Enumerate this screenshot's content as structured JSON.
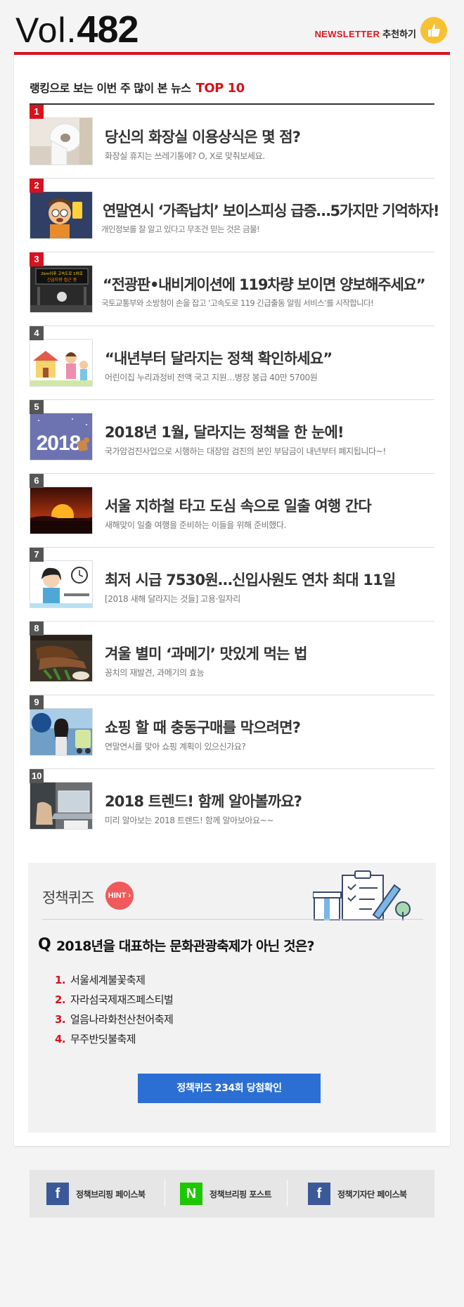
{
  "header": {
    "vol_prefix": "Vol.",
    "vol_number": "482",
    "newsletter_label": "NEWSLETTER",
    "recommend_label": "추천하기"
  },
  "section": {
    "title": "랭킹으로 보는 이번 주 많이 본 뉴스",
    "top_label": "TOP 10"
  },
  "items": [
    {
      "rank": "1",
      "title": "당신의 화장실 이용상식은 몇 점?",
      "subtitle": "화장실 휴지는 쓰레기통에? O, X로 맞춰보세요."
    },
    {
      "rank": "2",
      "title": "연말연시 ‘가족납치’ 보이스피싱 급증…5가지만 기억하자!",
      "subtitle": "개인정보를 잘 알고 있다고 무조건 믿는 것은 금물!"
    },
    {
      "rank": "3",
      "title": "“전광판•내비게이션에 119차량 보이면 양보해주세요”",
      "subtitle": "국토교통부와 소방청이 손을 잡고 ‘고속도로 119 긴급출동 알림 서비스’를 시작합니다!"
    },
    {
      "rank": "4",
      "title": "“내년부터 달라지는 정책 확인하세요”",
      "subtitle": "어린이집 누리과정비 전액 국고 지원…병장 봉급 40만 5700원"
    },
    {
      "rank": "5",
      "title": "2018년 1월, 달라지는 정책을 한 눈에!",
      "subtitle": "국가암검진사업으로 시행하는 대장암 검진의 본인 부담금이 내년부터 폐지됩니다~!"
    },
    {
      "rank": "6",
      "title": "서울 지하철 타고 도심 속으로 일출 여행 간다",
      "subtitle": "새해맞이 일출 여행을 준비하는 이들을 위해 준비했다."
    },
    {
      "rank": "7",
      "title": "최저 시급 7530원…신입사원도 연차 최대 11일",
      "subtitle": "[2018 새해 달라지는 것들] 고용·일자리"
    },
    {
      "rank": "8",
      "title": "겨울 별미 ‘과메기’ 맛있게 먹는 법",
      "subtitle": "꽁치의 재발견, 과메기의 효능"
    },
    {
      "rank": "9",
      "title": "쇼핑 할 때 충동구매를 막으려면?",
      "subtitle": "연말연시를 맞아 쇼핑 계획이 있으신가요?"
    },
    {
      "rank": "10",
      "title": "2018 트렌드! 함께 알아볼까요?",
      "subtitle": "미리 알아보는 2018 트렌드! 함께 알아보아요~~"
    }
  ],
  "thumb_texts": {
    "item3_sign_line1": "2km이후 고속도로 1차로",
    "item3_sign_line2": "긴급차량 접근 중",
    "item5_year": "2018"
  },
  "quiz": {
    "title": "정책퀴즈",
    "hint_label": "HINT",
    "q_mark": "Q",
    "question": "2018년을 대표하는 문화관광축제가 아닌 것은?",
    "options": [
      {
        "num": "1.",
        "text": "서울세계불꽃축제"
      },
      {
        "num": "2.",
        "text": "자라섬국제재즈페스티벌"
      },
      {
        "num": "3.",
        "text": "얼음나라화천산천어축제"
      },
      {
        "num": "4.",
        "text": "무주반딧불축제"
      }
    ],
    "button_label": "정책퀴즈 234회 당첨확인"
  },
  "footer": {
    "links": [
      {
        "label": "정책브리핑 페이스북",
        "icon": "facebook-icon",
        "glyph": "f",
        "color": "#3b5998"
      },
      {
        "label": "정책브리핑 포스트",
        "icon": "naver-post-icon",
        "glyph": "N",
        "color": "#1ec800"
      },
      {
        "label": "정책기자단 페이스북",
        "icon": "facebook-icon",
        "glyph": "f",
        "color": "#3b5998"
      }
    ]
  },
  "colors": {
    "accent_red": "#d8121e",
    "button_blue": "#2c6fd4",
    "hint_red": "#f05a5a",
    "thumb_yellow": "#f6c233"
  }
}
